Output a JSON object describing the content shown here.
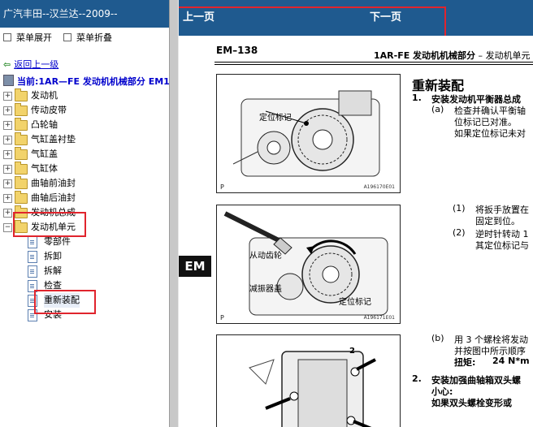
{
  "left_pane": {
    "title": "广汽丰田--汉兰达--2009--",
    "menu": {
      "expand_label": "菜单展开",
      "collapse_label": "菜单折叠"
    },
    "back_label": "返回上一级",
    "current_label": "当前:1AR—FE 发动机机械部分 EM1",
    "tree": [
      {
        "label": "发动机",
        "expander": "+"
      },
      {
        "label": "传动皮带",
        "expander": "+"
      },
      {
        "label": "凸轮轴",
        "expander": "+"
      },
      {
        "label": "气缸盖衬垫",
        "expander": "+"
      },
      {
        "label": "气缸盖",
        "expander": "+"
      },
      {
        "label": "气缸体",
        "expander": "+"
      },
      {
        "label": "曲轴前油封",
        "expander": "+"
      },
      {
        "label": "曲轴后油封",
        "expander": "+"
      },
      {
        "label": "发动机总成",
        "expander": "+"
      },
      {
        "label": "发动机单元",
        "expander": "−"
      }
    ],
    "leaves": [
      {
        "label": "零部件"
      },
      {
        "label": "拆卸"
      },
      {
        "label": "拆解"
      },
      {
        "label": "检查"
      },
      {
        "label": "重新装配"
      },
      {
        "label": "安装"
      }
    ]
  },
  "nav": {
    "prev_label": "上一页",
    "next_label": "下一页"
  },
  "document": {
    "page_code": "EM–138",
    "header_bold": "1AR-FE 发动机机械部分",
    "header_dash": " – ",
    "header_section": "发动机单元",
    "side_tab": "EM",
    "section_title": "重新装配",
    "step1": {
      "num": "1.",
      "text": "安装发动机平衡器总成"
    },
    "step1a": {
      "num": "(a)",
      "line1": "检查并确认平衡轴",
      "line2": "位标记已对准。",
      "line3": "如果定位标记未对"
    },
    "sub1": {
      "num": "(1)",
      "line1": "将扳手放置在",
      "line2": "固定到位。"
    },
    "sub2": {
      "num": "(2)",
      "line1": "逆时针转动 1",
      "line2": "其定位标记与"
    },
    "step1b": {
      "num": "(b)",
      "line1": "用 3 个螺栓将发动",
      "line2": "并按图中所示顺序",
      "torque_label": "扭矩:",
      "torque_value": "24 N*m ("
    },
    "step2": {
      "num": "2.",
      "line1": "安装加强曲轴箱双头螺",
      "line2": "小心:",
      "line3": "如果双头螺栓变形或"
    },
    "figures": [
      {
        "code": "A196170E01",
        "p": "P",
        "labels": [
          "定位标记"
        ]
      },
      {
        "code": "A196171E01",
        "p": "P",
        "labels": [
          "从动齿轮",
          "减振器盖",
          "定位标记"
        ]
      },
      {
        "code": "",
        "p": "",
        "labels": [
          "2"
        ]
      }
    ]
  },
  "colors": {
    "title_bar": "#1f5a8f",
    "highlight": "#e0242d",
    "link": "#0000cc"
  }
}
